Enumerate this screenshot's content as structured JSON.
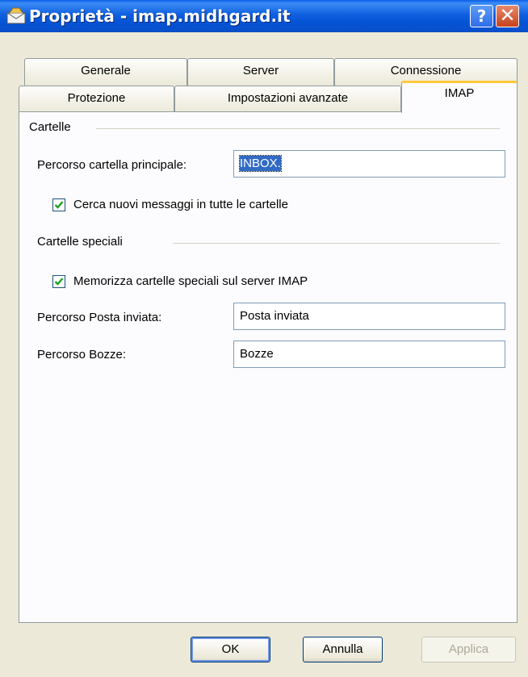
{
  "window": {
    "title": "Proprietà - imap.midhgard.it",
    "help_glyph": "?",
    "close_glyph": "✕",
    "icon": "mail-account-icon"
  },
  "tabs": {
    "row1": [
      {
        "label": "Generale"
      },
      {
        "label": "Server"
      },
      {
        "label": "Connessione"
      }
    ],
    "row2": [
      {
        "label": "Protezione"
      },
      {
        "label": "Impostazioni avanzate"
      },
      {
        "label": "IMAP",
        "active": true
      }
    ]
  },
  "imap": {
    "folders_group": "Cartelle",
    "root_path_label": "Percorso cartella principale:",
    "root_path_value": "INBOX.",
    "check_all_label": "Cerca nuovi messaggi in tutte le cartelle",
    "check_all_checked": true,
    "special_group": "Cartelle speciali",
    "store_special_label": "Memorizza cartelle speciali sul server IMAP",
    "store_special_checked": true,
    "sent_label": "Percorso Posta inviata:",
    "sent_value": "Posta inviata",
    "drafts_label": "Percorso Bozze:",
    "drafts_value": "Bozze"
  },
  "buttons": {
    "ok": "OK",
    "cancel": "Annulla",
    "apply": "Applica"
  },
  "colors": {
    "titlebar": "#0553d6",
    "active_tab_accent": "#ffc83c",
    "selection": "#316ac5",
    "checkmark": "#21a121"
  }
}
